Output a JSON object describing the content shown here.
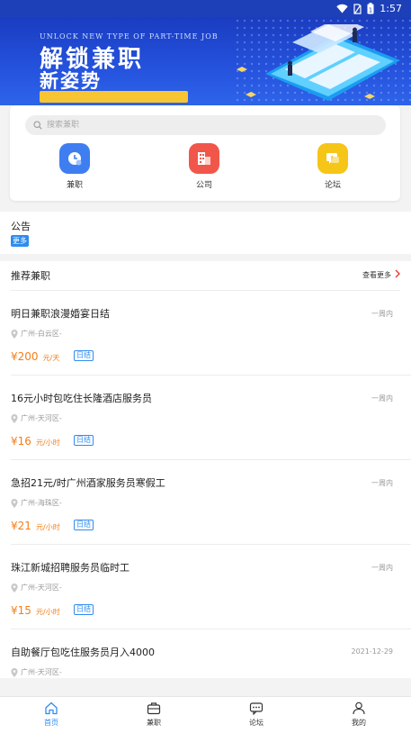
{
  "status_bar": {
    "battery_label": "1",
    "time": "1:57"
  },
  "banner": {
    "english_text": "UNLOCK NEW TYPE OF PART-TIME JOB",
    "title_line1": "解锁兼职",
    "title_line2": "新姿势",
    "tagline": ""
  },
  "search": {
    "placeholder": "搜索兼职"
  },
  "categories": [
    {
      "label": "兼职",
      "icon": "clock-icon",
      "color": "#3f7ef0"
    },
    {
      "label": "公司",
      "icon": "building-icon",
      "color": "#f0574a"
    },
    {
      "label": "论坛",
      "icon": "forum-icon",
      "color": "#f5c518"
    }
  ],
  "notice": {
    "title": "公告",
    "more": "更多"
  },
  "recommend": {
    "title": "推荐兼职",
    "more": "查看更多",
    "jobs": [
      {
        "title": "明日兼职浪漫婚宴日结",
        "time": "一周内",
        "location": "广州-白云区-",
        "currency": "¥",
        "price": "200",
        "unit": "元/天",
        "tag": "日结"
      },
      {
        "title": "16元小时包吃住长隆酒店服务员",
        "time": "一周内",
        "location": "广州-天河区-",
        "currency": "¥",
        "price": "16",
        "unit": "元/小时",
        "tag": "日结"
      },
      {
        "title": "急招21元/时广州酒家服务员寒假工",
        "time": "一周内",
        "location": "广州-海珠区-",
        "currency": "¥",
        "price": "21",
        "unit": "元/小时",
        "tag": "日结"
      },
      {
        "title": "珠江新城招聘服务员临时工",
        "time": "一周内",
        "location": "广州-天河区-",
        "currency": "¥",
        "price": "15",
        "unit": "元/小时",
        "tag": "日结"
      },
      {
        "title": "自助餐厅包吃住服务员月入4000",
        "time": "2021-12-29",
        "location": "广州-天河区-",
        "currency": "",
        "price": "",
        "unit": "",
        "tag": ""
      }
    ]
  },
  "tabs": [
    {
      "label": "首页",
      "icon": "home-icon",
      "active": true
    },
    {
      "label": "兼职",
      "icon": "briefcase-icon",
      "active": false
    },
    {
      "label": "论坛",
      "icon": "chat-icon",
      "active": false
    },
    {
      "label": "我的",
      "icon": "user-icon",
      "active": false
    }
  ],
  "colors": {
    "accent": "#2f8cf0",
    "price": "#f57e19",
    "banner": "#1d3fb8"
  }
}
